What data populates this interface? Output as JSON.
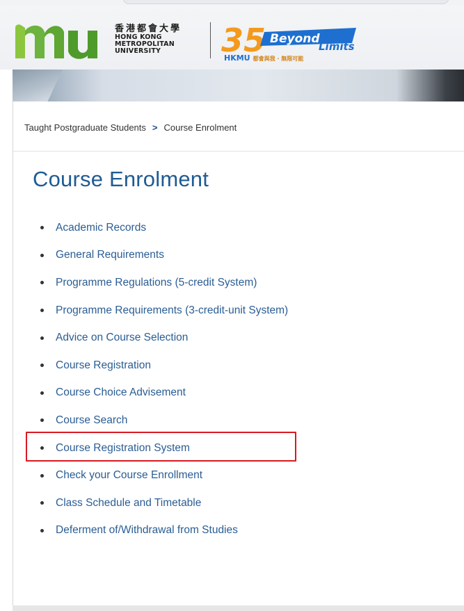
{
  "header": {
    "university_cn": "香港都會大學",
    "university_en_line1": "HONG KONG",
    "university_en_line2": "METROPOLITAN",
    "university_en_line3": "UNIVERSITY",
    "anniversary_number": "35",
    "anniversary_word_1": "Beyond",
    "anniversary_word_2": "Limits",
    "brand_short": "HKMU",
    "brand_slogan": "都會與我 · 無限可能"
  },
  "breadcrumb": {
    "parent": "Taught Postgraduate Students",
    "separator": ">",
    "current": "Course Enrolment"
  },
  "page": {
    "title": "Course Enrolment"
  },
  "menu": {
    "items": [
      {
        "label": "Academic Records"
      },
      {
        "label": "General Requirements"
      },
      {
        "label": "Programme Regulations (5-credit System)"
      },
      {
        "label": "Programme Requirements (3-credit-unit System)"
      },
      {
        "label": "Advice on Course Selection"
      },
      {
        "label": "Course Registration"
      },
      {
        "label": "Course Choice Advisement"
      },
      {
        "label": "Course Search"
      },
      {
        "label": "Course Registration System"
      },
      {
        "label": "Check your Course Enrollment"
      },
      {
        "label": "Class Schedule and Timetable"
      },
      {
        "label": "Deferment of/Withdrawal from Studies"
      }
    ],
    "highlighted_index": 8
  },
  "colors": {
    "link": "#2a5d94",
    "title": "#1f5b93",
    "highlight_border": "#d71920",
    "logo_green": "#6db33f",
    "anniversary_orange": "#f39a1e",
    "brand_blue": "#1e6fd0"
  }
}
